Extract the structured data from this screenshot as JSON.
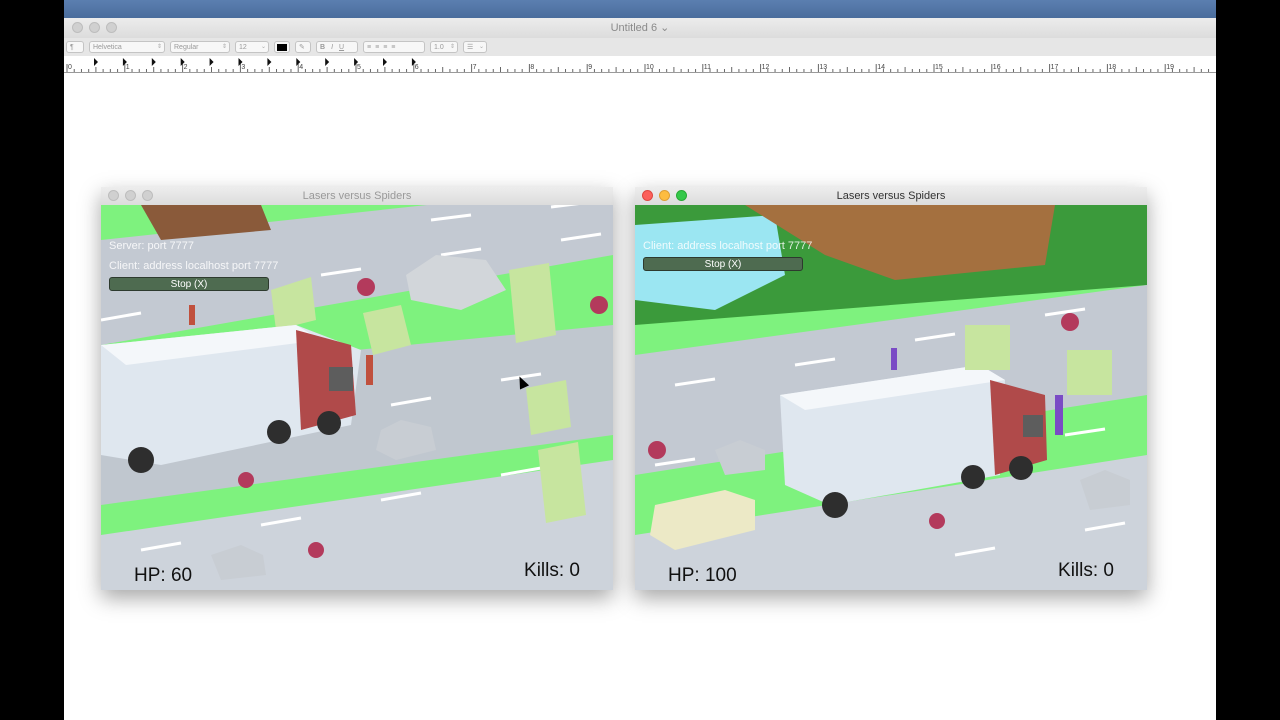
{
  "doc": {
    "title": "Untitled 6",
    "title_chevron": "⌄",
    "toolbar": {
      "paragraph": "¶",
      "font": "Helvetica",
      "style": "Regular",
      "size": "12",
      "bold": "B",
      "italic": "I",
      "underline": "U",
      "spacing": "1.0"
    },
    "ruler_numbers": [
      "0",
      "1",
      "2",
      "3",
      "4",
      "5",
      "6",
      "7",
      "8",
      "9",
      "10",
      "11",
      "12",
      "13",
      "14",
      "15",
      "16",
      "17",
      "18",
      "19"
    ]
  },
  "left_game": {
    "title": "Lasers versus Spiders",
    "server_text": "Server: port 7777",
    "client_text": "Client: address localhost port 7777",
    "stop_label": "Stop (X)",
    "hp_text": "HP: 60",
    "kills_text": "Kills: 0"
  },
  "right_game": {
    "title": "Lasers versus Spiders",
    "client_text": "Client: address localhost port 7777",
    "stop_label": "Stop (X)",
    "hp_text": "HP: 100",
    "kills_text": "Kills: 0"
  }
}
